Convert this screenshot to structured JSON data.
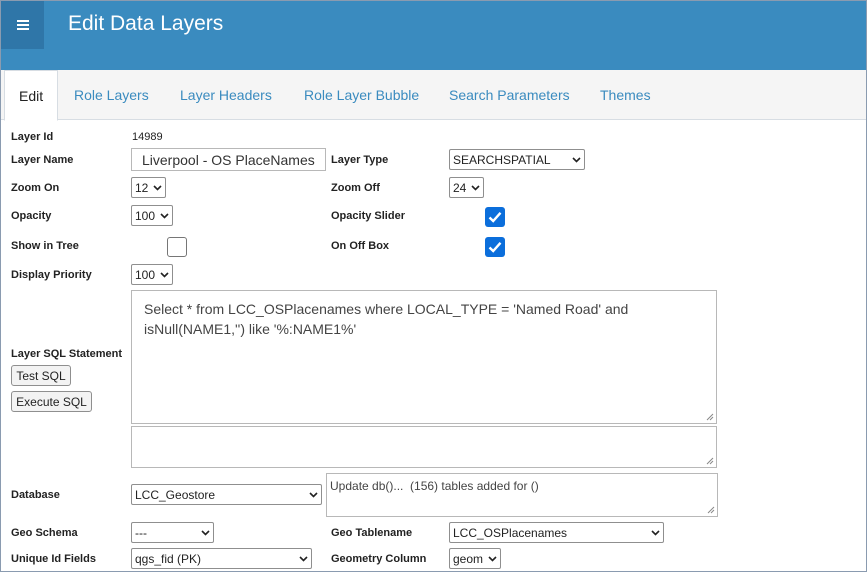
{
  "header": {
    "title": "Edit Data Layers",
    "menu_icon": "hamburger-menu-icon"
  },
  "tabs": [
    {
      "label": "Edit",
      "active": true
    },
    {
      "label": "Role Layers"
    },
    {
      "label": "Layer Headers"
    },
    {
      "label": "Role Layer Bubble"
    },
    {
      "label": "Search Parameters"
    },
    {
      "label": "Themes"
    }
  ],
  "form": {
    "layer_id": {
      "label": "Layer Id",
      "value": "14989"
    },
    "layer_name": {
      "label": "Layer Name",
      "value": "Liverpool - OS PlaceNames"
    },
    "layer_type": {
      "label": "Layer Type",
      "value": "SEARCHSPATIAL"
    },
    "zoom_on": {
      "label": "Zoom On",
      "value": "12"
    },
    "zoom_off": {
      "label": "Zoom Off",
      "value": "24"
    },
    "opacity": {
      "label": "Opacity",
      "value": "100"
    },
    "opacity_slider": {
      "label": "Opacity Slider",
      "checked": true
    },
    "show_in_tree": {
      "label": "Show in Tree",
      "checked": false
    },
    "on_off_box": {
      "label": "On Off Box",
      "checked": true
    },
    "display_priority": {
      "label": "Display Priority",
      "value": "100"
    },
    "layer_sql": {
      "label": "Layer SQL Statement",
      "value": "Select * from LCC_OSPlacenames where LOCAL_TYPE = 'Named Road' and isNull(NAME1,'') like '%:NAME1%'",
      "secondary_value": ""
    },
    "test_sql_label": "Test SQL",
    "execute_sql_label": "Execute SQL",
    "database": {
      "label": "Database",
      "value": "LCC_Geostore",
      "status": "Update db()...  (156) tables added for ()"
    },
    "geo_schema": {
      "label": "Geo Schema",
      "value": "---"
    },
    "geo_tablename": {
      "label": "Geo Tablename",
      "value": "LCC_OSPlacenames"
    },
    "unique_id_fields": {
      "label": "Unique Id Fields",
      "value": "qgs_fid (PK)"
    },
    "geometry_column": {
      "label": "Geometry Column",
      "value": "geom"
    }
  },
  "colors": {
    "header": "#3a8bbf",
    "menu_button": "#2f76a8",
    "tab_link": "#3a8bbf",
    "checkbox": "#0b6edb"
  }
}
